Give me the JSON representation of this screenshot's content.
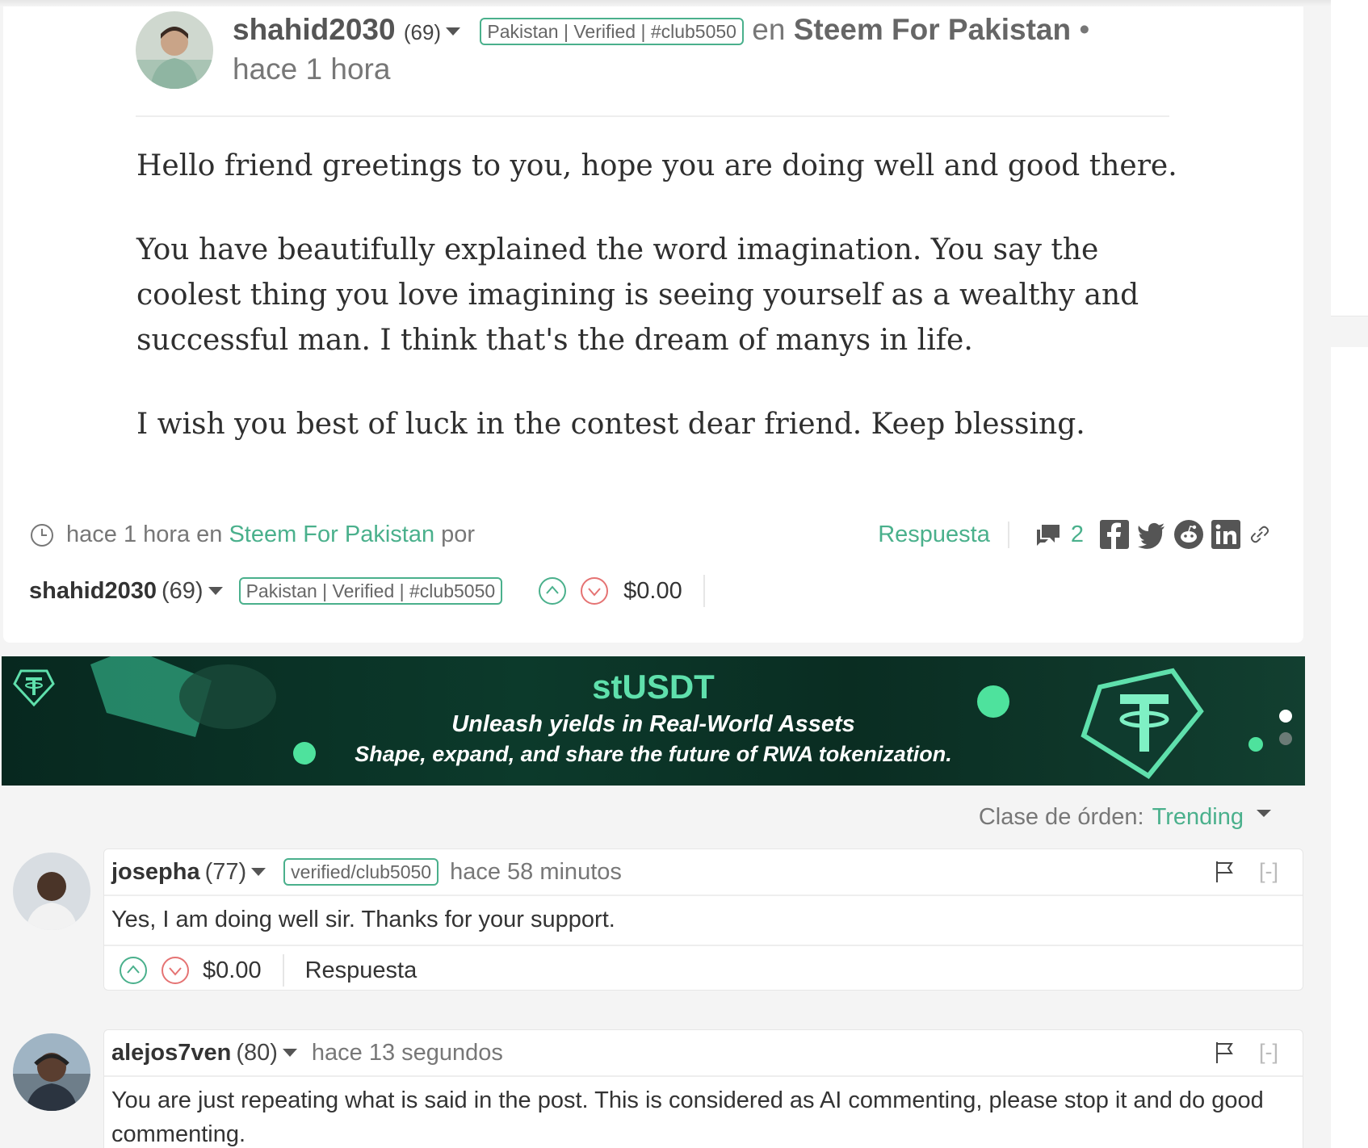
{
  "post": {
    "author": "shahid2030",
    "reputation": "(69)",
    "badge": "Pakistan | Verified | #club5050",
    "in_word": "en",
    "community": "Steem For Pakistan",
    "separator": "•",
    "time": "hace 1 hora",
    "paragraphs": [
      "Hello friend greetings to you, hope you are doing well and good there.",
      "You have beautifully explained the word imagination. You say the coolest thing you love imagining is seeing yourself as a wealthy and successful man. I think that's the dream of manys in life.",
      "I wish you best of luck in the contest dear friend. Keep blessing."
    ],
    "meta": {
      "time": "hace 1 hora",
      "in_word": "en",
      "community": "Steem For Pakistan",
      "by_word": "por"
    },
    "reply_label": "Respuesta",
    "comment_count": "2",
    "payout": "$0.00",
    "share_icons": [
      "facebook-icon",
      "twitter-icon",
      "reddit-icon",
      "linkedin-icon",
      "link-icon"
    ]
  },
  "banner": {
    "title": "stUSDT",
    "line1": "Unleash yields in Real-World Assets",
    "line2": "Shape, expand, and share the future of RWA tokenization."
  },
  "sort": {
    "label": "Clase de órden:",
    "value": "Trending"
  },
  "comments": [
    {
      "author": "josepha",
      "reputation": "(77)",
      "badge": "verified/club5050",
      "time": "hace 58 minutos",
      "collapse": "[-]",
      "text": "Yes, I am doing well sir. Thanks for your support.",
      "payout": "$0.00",
      "reply_label": "Respuesta"
    },
    {
      "author": "alejos7ven",
      "reputation": "(80)",
      "time": "hace 13 segundos",
      "collapse": "[-]",
      "text": "You are just repeating what is said in the post. This is considered as AI commenting, please stop it and do good commenting."
    }
  ],
  "colors": {
    "accent": "#4ab08c",
    "downvote": "#e57373",
    "banner_bg": "#0a2d22",
    "banner_title": "#5fe0ac"
  }
}
